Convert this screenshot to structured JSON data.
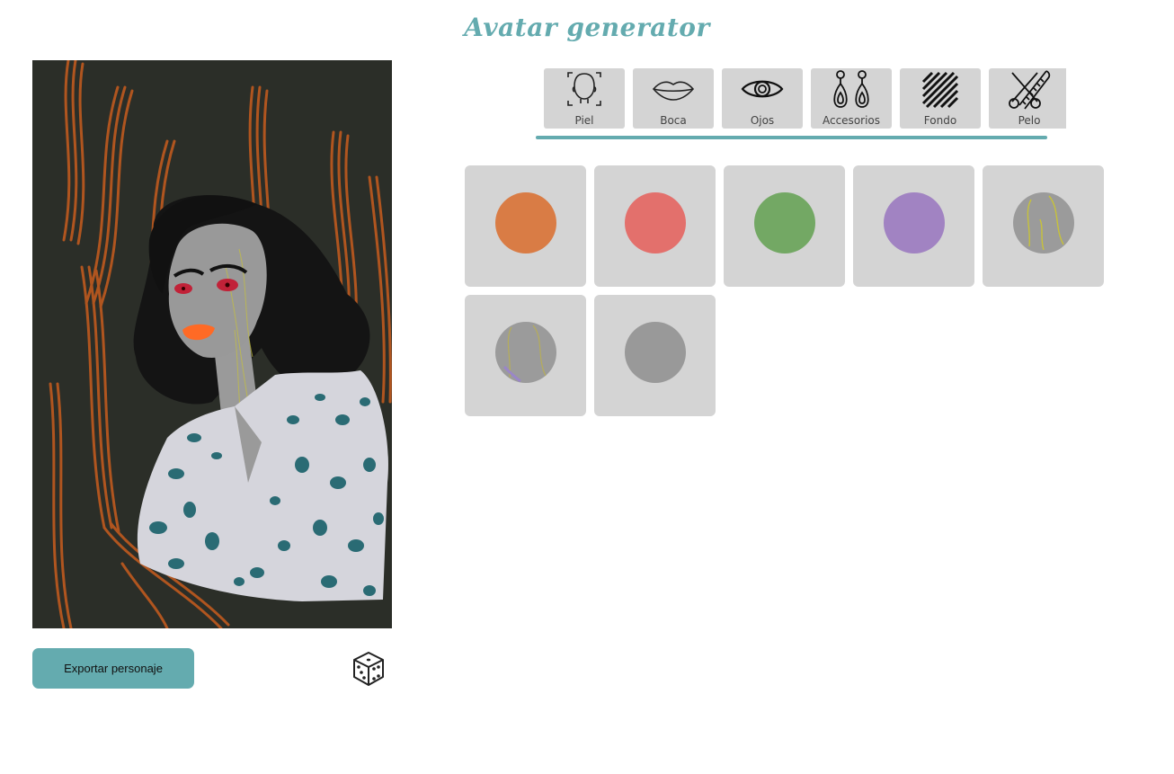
{
  "app": {
    "title": "Avatar generator"
  },
  "tabs": [
    {
      "label": "Piel",
      "icon": "face-icon"
    },
    {
      "label": "Boca",
      "icon": "lips-icon"
    },
    {
      "label": "Ojos",
      "icon": "eye-icon"
    },
    {
      "label": "Accesorios",
      "icon": "earrings-icon"
    },
    {
      "label": "Fondo",
      "icon": "stripes-icon"
    },
    {
      "label": "Pelo",
      "icon": "scissors-comb-icon"
    }
  ],
  "active_tab": "Piel",
  "swatches": [
    {
      "name": "orange",
      "color": "#d97c45"
    },
    {
      "name": "coral",
      "color": "#e3706c"
    },
    {
      "name": "green",
      "color": "#73a864"
    },
    {
      "name": "purple",
      "color": "#a183c2"
    },
    {
      "name": "gray-yellow-veins",
      "color": "#9b9b9b",
      "pattern": "yellow-veins"
    },
    {
      "name": "gray-purple-veins",
      "color": "#9b9b9b",
      "pattern": "purple-veins"
    },
    {
      "name": "gray",
      "color": "#999999"
    }
  ],
  "actions": {
    "export_label": "Exportar personaje",
    "random_icon": "dice-icon"
  },
  "colors": {
    "accent": "#64abaf",
    "tile": "#d4d4d4",
    "avatar_bg": "#2b2e28",
    "stroke_orange": "#c85c1e"
  }
}
